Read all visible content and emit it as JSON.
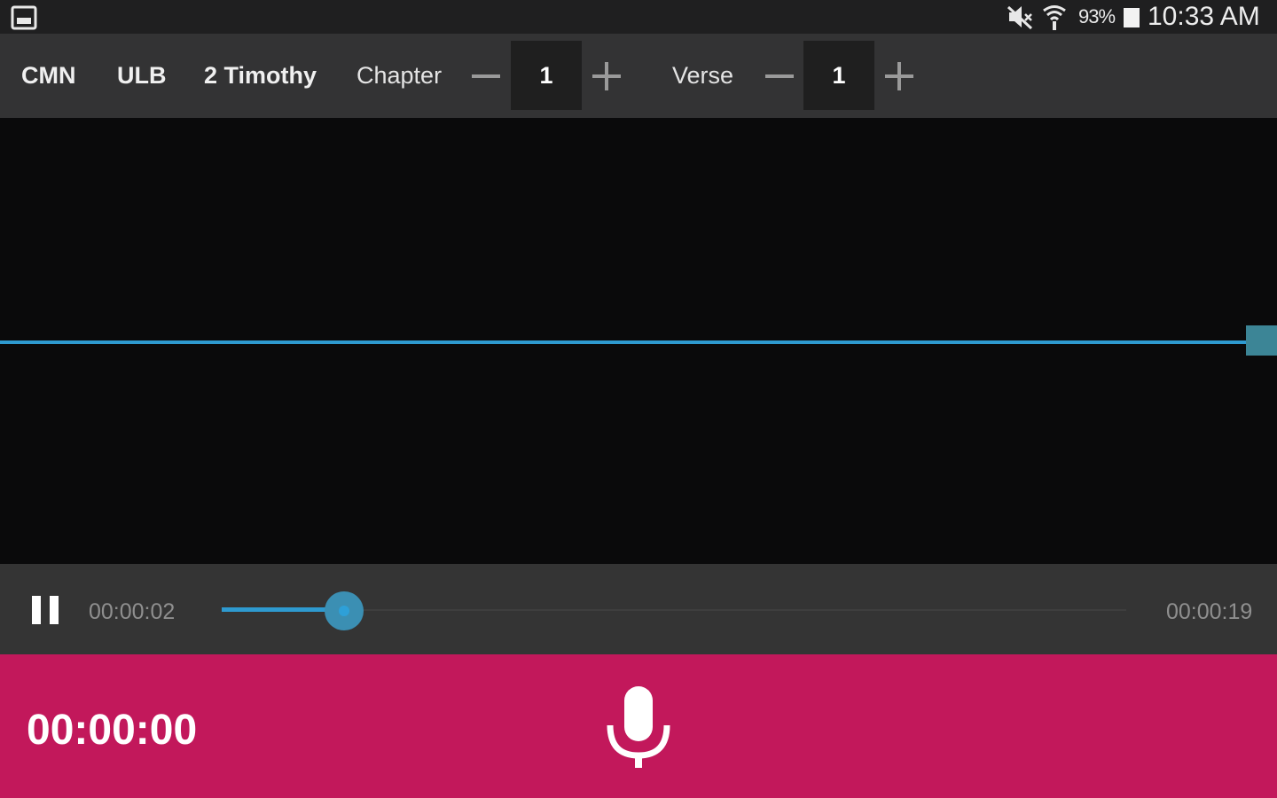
{
  "status_bar": {
    "battery_pct": "93%",
    "clock": "10:33 AM",
    "icons": [
      "gallery-icon",
      "mute-icon",
      "wifi-icon",
      "battery-icon"
    ]
  },
  "toolbar": {
    "language": "CMN",
    "version": "ULB",
    "book": "2 Timothy",
    "chapter_label": "Chapter",
    "chapter_value": "1",
    "verse_label": "Verse",
    "verse_value": "1",
    "icons": [
      "minus-icon",
      "plus-icon"
    ]
  },
  "player": {
    "elapsed": "00:00:02",
    "total": "00:00:19",
    "progress": 0.135,
    "icons": [
      "pause-icon"
    ]
  },
  "record": {
    "timer": "00:00:00",
    "icons": [
      "microphone-icon"
    ]
  },
  "colors": {
    "accent_blue": "#2e9ad0",
    "record_bar": "#c2185b",
    "toolbar_bg": "#333334",
    "waveform_bg": "#0a0a0b"
  }
}
